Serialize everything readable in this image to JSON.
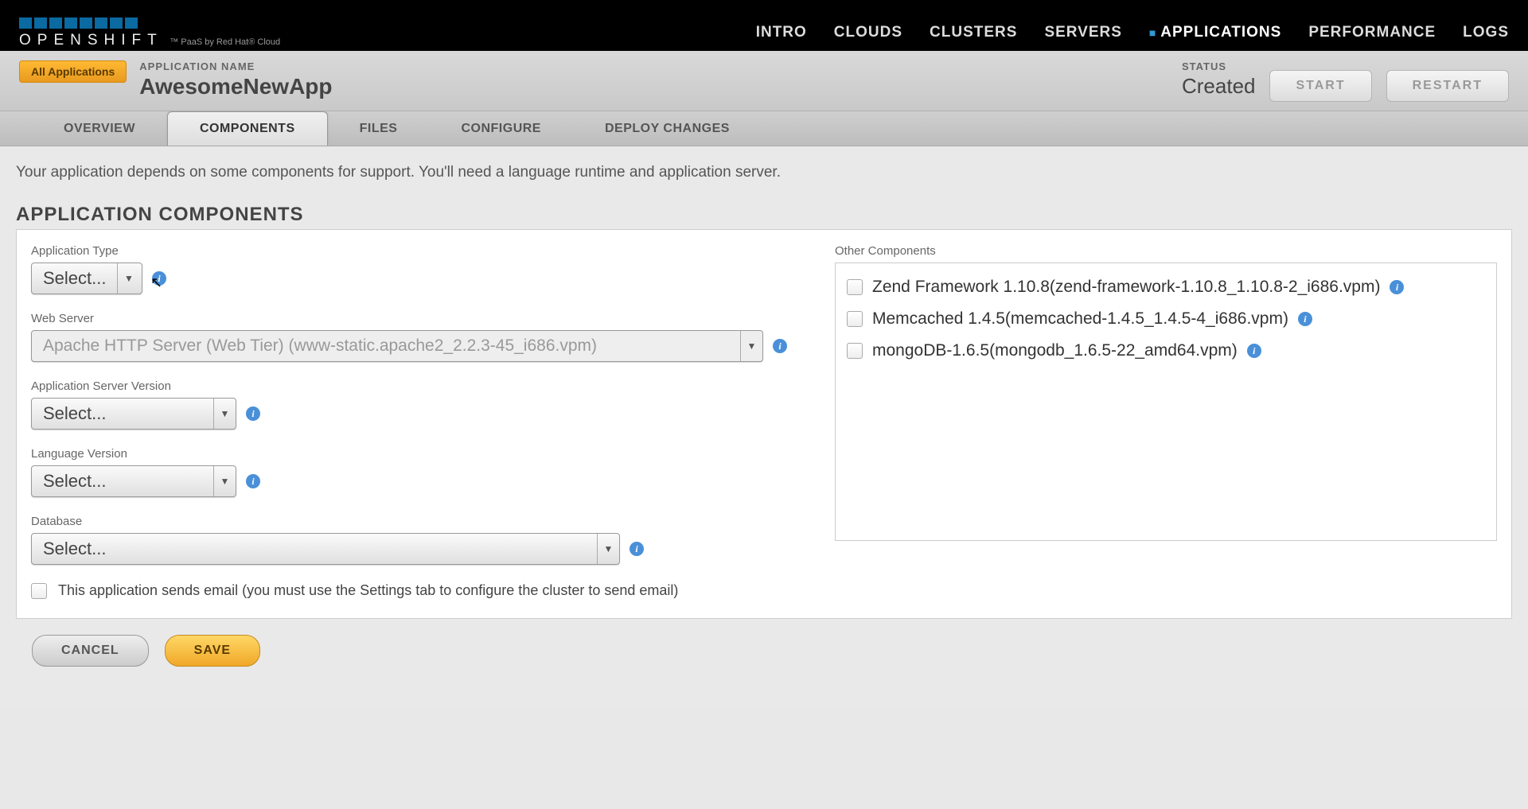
{
  "brand": {
    "name": "OPENSHIFT",
    "tagline": "™ PaaS by Red Hat® Cloud"
  },
  "topnav": {
    "items": [
      "INTRO",
      "CLOUDS",
      "CLUSTERS",
      "SERVERS",
      "APPLICATIONS",
      "PERFORMANCE",
      "LOGS"
    ],
    "active": "APPLICATIONS"
  },
  "breadcrumb": {
    "all_apps": "All Applications"
  },
  "app": {
    "label": "APPLICATION NAME",
    "name": "AwesomeNewApp",
    "status_label": "STATUS",
    "status_value": "Created"
  },
  "actions": {
    "start": "START",
    "restart": "RESTART"
  },
  "tabs": {
    "items": [
      "OVERVIEW",
      "COMPONENTS",
      "FILES",
      "CONFIGURE",
      "DEPLOY CHANGES"
    ],
    "active": "COMPONENTS"
  },
  "intro": "Your application depends on some components for support.  You'll need a language runtime and application server.",
  "section_title": "APPLICATION COMPONENTS",
  "form": {
    "app_type": {
      "label": "Application Type",
      "value": "Select..."
    },
    "web_server": {
      "label": "Web Server",
      "value": "Apache HTTP Server (Web Tier) (www-static.apache2_2.2.3-45_i686.vpm)"
    },
    "app_server_version": {
      "label": "Application Server Version",
      "value": "Select..."
    },
    "language_version": {
      "label": "Language Version",
      "value": "Select..."
    },
    "database": {
      "label": "Database",
      "value": "Select..."
    },
    "email_checkbox": "This application sends email (you must use the Settings tab to configure the cluster to send email)"
  },
  "other": {
    "label": "Other Components",
    "items": [
      "Zend Framework 1.10.8(zend-framework-1.10.8_1.10.8-2_i686.vpm)",
      "Memcached 1.4.5(memcached-1.4.5_1.4.5-4_i686.vpm)",
      "mongoDB-1.6.5(mongodb_1.6.5-22_amd64.vpm)"
    ]
  },
  "footer": {
    "cancel": "CANCEL",
    "save": "SAVE"
  }
}
